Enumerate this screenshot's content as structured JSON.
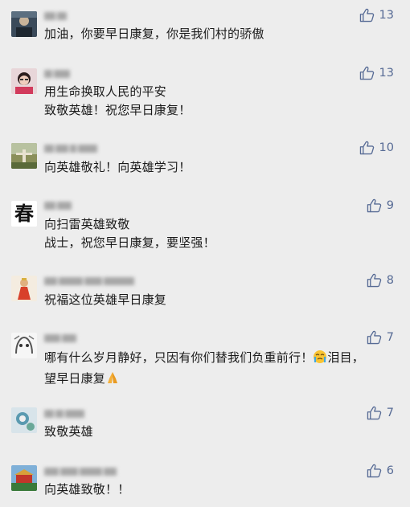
{
  "colors": {
    "background": "#ededed",
    "like_accent": "#576b95",
    "text": "#1a1a1a"
  },
  "icons": {
    "like": "thumbs-up-outline-icon"
  },
  "comments": [
    {
      "lines": [
        "加油，你要早日康复，你是我们村的骄傲"
      ],
      "likes": "13"
    },
    {
      "lines": [
        "用生命换取人民的平安",
        "致敬英雄！祝您早日康复！"
      ],
      "likes": "13"
    },
    {
      "lines": [
        "向英雄敬礼！向英雄学习！"
      ],
      "likes": "10"
    },
    {
      "avatar_text": "春",
      "lines": [
        "向扫雷英雄致敬",
        "战士，祝您早日康复，要坚强！"
      ],
      "likes": "9"
    },
    {
      "lines": [
        "祝福这位英雄早日康复"
      ],
      "likes": "8"
    },
    {
      "lines": [
        "哪有什么岁月静好，只因有你们替我们负重前行！",
        "望早日康复"
      ],
      "inline_text": "泪目，",
      "likes": "7"
    },
    {
      "lines": [
        "致敬英雄"
      ],
      "likes": "7"
    },
    {
      "lines": [
        "向英雄致敬！！"
      ],
      "likes": "6"
    }
  ]
}
